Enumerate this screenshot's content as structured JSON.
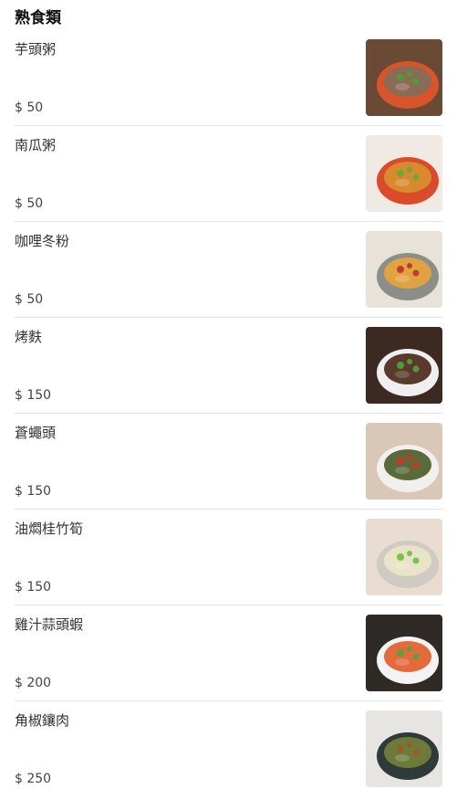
{
  "section": {
    "title": "熟食類"
  },
  "items": [
    {
      "name": "芋頭粥",
      "price": "$ 50",
      "image": "taro-porridge-photo",
      "colors": {
        "bg": "#6b4a35",
        "plate": "#d8542b",
        "food": "#8a6b55",
        "garnish": "#4e9b3a"
      }
    },
    {
      "name": "南瓜粥",
      "price": "$ 50",
      "image": "pumpkin-porridge-photo",
      "colors": {
        "bg": "#f1e9e4",
        "plate": "#d94b2b",
        "food": "#d98a2e",
        "garnish": "#6fa83a"
      }
    },
    {
      "name": "咖哩冬粉",
      "price": "$ 50",
      "image": "curry-vermicelli-photo",
      "colors": {
        "bg": "#e9e2d8",
        "plate": "#8a8f8a",
        "food": "#e0a341",
        "garnish": "#c23b2b"
      }
    },
    {
      "name": "烤麩",
      "price": "$ 150",
      "image": "braised-gluten-photo",
      "colors": {
        "bg": "#3c2a22",
        "plate": "#efefef",
        "food": "#5a3a2a",
        "garnish": "#4f9a3c"
      }
    },
    {
      "name": "蒼蠅頭",
      "price": "$ 150",
      "image": "flies-head-photo",
      "colors": {
        "bg": "#d9c8b8",
        "plate": "#f2f0ec",
        "food": "#5b6a3a",
        "garnish": "#c8362a"
      }
    },
    {
      "name": "油燜桂竹筍",
      "price": "$ 150",
      "image": "braised-bamboo-shoots-photo",
      "colors": {
        "bg": "#e8ddd0",
        "plate": "#cfcac2",
        "food": "#e9e3c8",
        "garnish": "#7cc24a"
      }
    },
    {
      "name": "雞汁蒜頭蝦",
      "price": "$ 200",
      "image": "garlic-shrimp-photo",
      "colors": {
        "bg": "#2f2a26",
        "plate": "#f3f3f3",
        "food": "#e36a3b",
        "garnish": "#5aa142"
      }
    },
    {
      "name": "角椒鑲肉",
      "price": "$ 250",
      "image": "stuffed-peppers-photo",
      "colors": {
        "bg": "#e7e5e2",
        "plate": "#2f3a3a",
        "food": "#6d7a3a",
        "garnish": "#9c5a2a"
      }
    }
  ]
}
